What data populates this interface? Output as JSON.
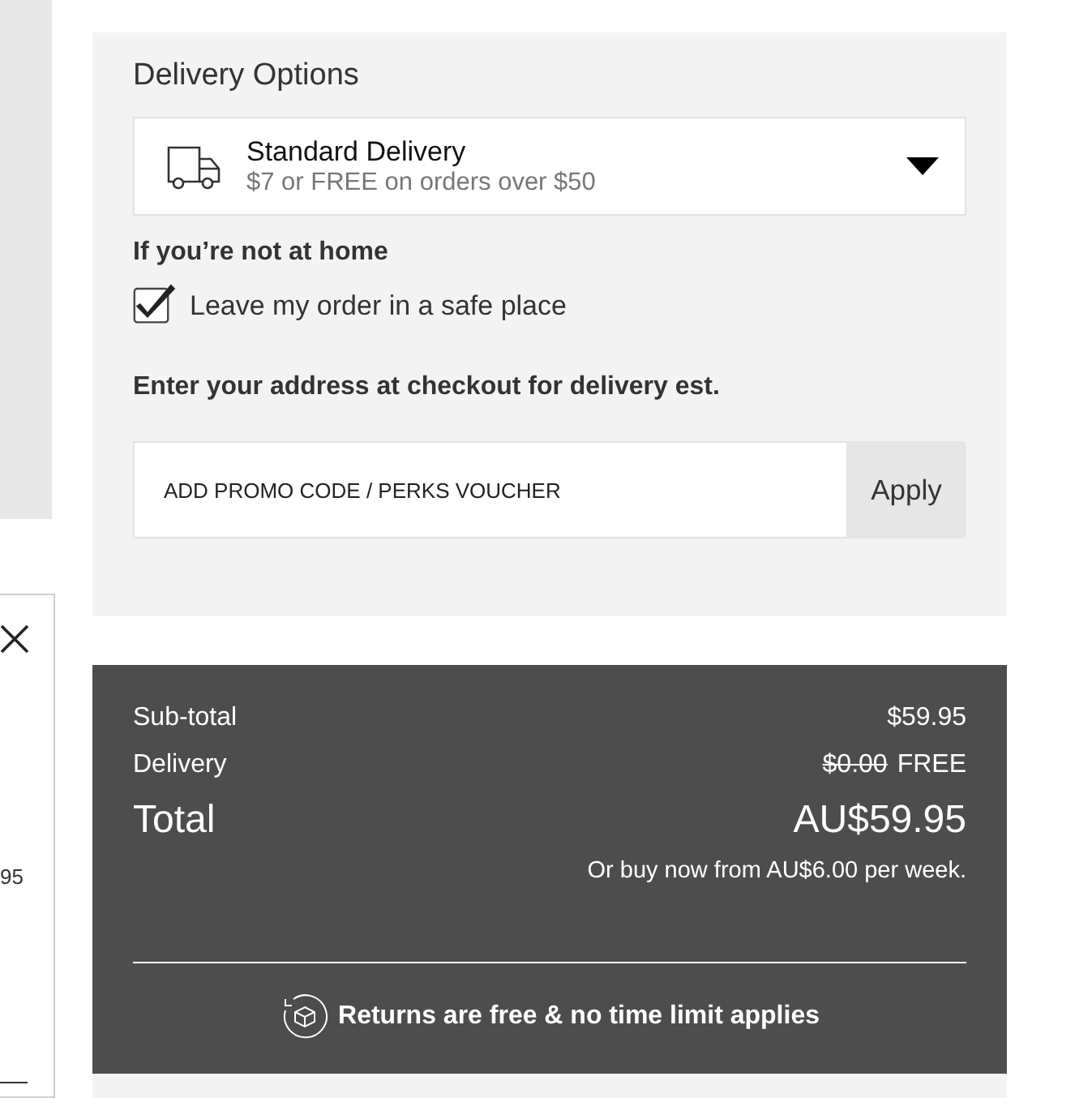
{
  "side_card": {
    "price_fragment": "95"
  },
  "delivery_options": {
    "title": "Delivery Options",
    "selected_option": {
      "name": "Standard Delivery",
      "detail": "$7 or FREE on orders over $50"
    },
    "not_home_heading": "If you’re not at home",
    "safe_place": {
      "label": "Leave my order in a safe place",
      "checked": true
    },
    "address_note": "Enter your address at checkout for delivery est.",
    "promo": {
      "placeholder": "ADD PROMO CODE / PERKS VOUCHER",
      "button": "Apply"
    }
  },
  "summary": {
    "subtotal": {
      "label": "Sub-total",
      "value": "$59.95"
    },
    "delivery": {
      "label": "Delivery",
      "original": "$0.00",
      "value": "FREE"
    },
    "total": {
      "label": "Total",
      "value": "AU$59.95"
    },
    "installment": "Or buy now from AU$6.00 per week.",
    "returns": "Returns are free & no time limit applies"
  }
}
